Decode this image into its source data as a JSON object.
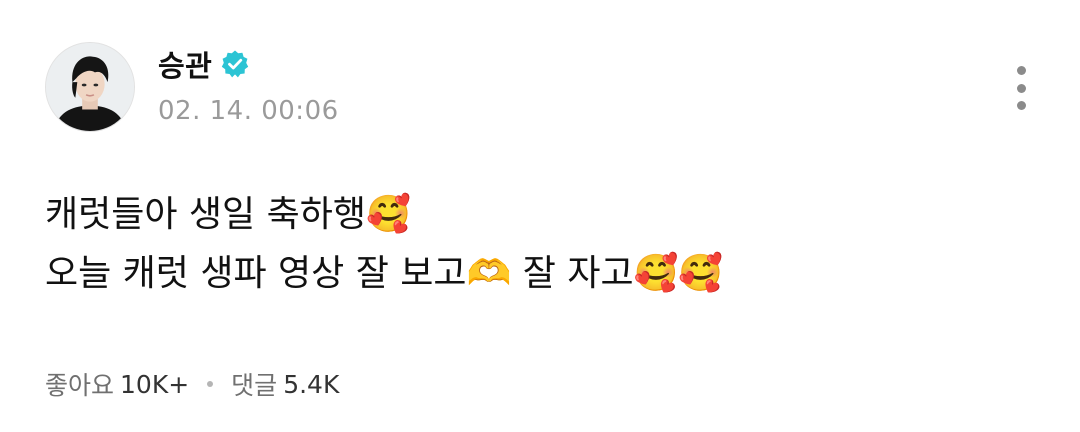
{
  "post": {
    "author": {
      "name": "승관",
      "verified": true,
      "avatar_icon": "profile-photo"
    },
    "timestamp": "02. 14. 00:06",
    "content_lines": [
      "캐럿들아 생일 축하행🥰",
      "오늘 캐럿 생파 영상 잘 보고🫶 잘 자고🥰🥰"
    ],
    "stats": {
      "likes_label": "좋아요",
      "likes_count": "10K+",
      "comments_label": "댓글",
      "comments_count": "5.4K"
    },
    "menu_icon": "more-vertical-icon",
    "colors": {
      "verified_badge": "#2cc4d4",
      "timestamp": "#9a9a9a",
      "menu_dots": "#8b8b8b"
    }
  }
}
